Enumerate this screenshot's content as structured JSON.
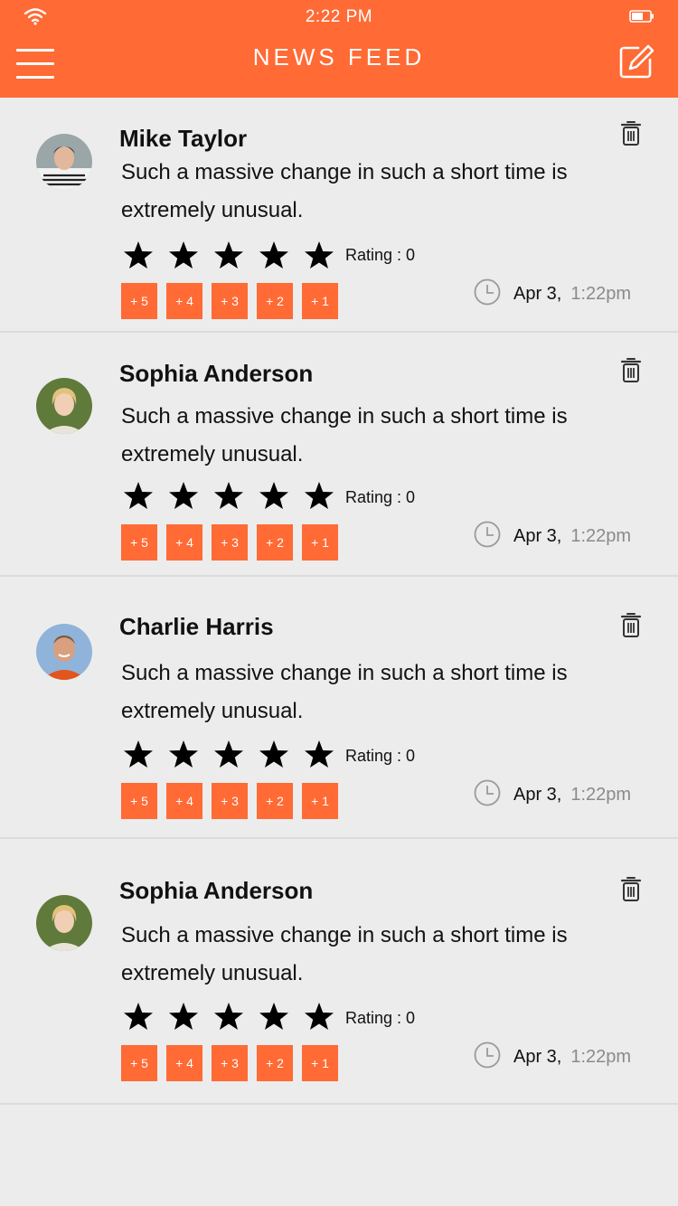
{
  "status_bar": {
    "time": "2:22 PM"
  },
  "header": {
    "title": "NEWS FEED"
  },
  "colors": {
    "accent": "#ff6a35",
    "background": "#ececec"
  },
  "posts": [
    {
      "name": "Mike Taylor",
      "message": "Such a massive change in such a short time is extremely unusual.",
      "rating_label": "Rating : 0",
      "stars": 5,
      "chips": [
        "+ 5",
        "+ 4",
        "+ 3",
        "+ 2",
        "+ 1"
      ],
      "date": "Apr 3,",
      "time": "1:22pm",
      "avatar_icon": "user-avatar-1"
    },
    {
      "name": "Sophia Anderson",
      "message": "Such a massive change in such a short time is extremely unusual.",
      "rating_label": "Rating : 0",
      "stars": 5,
      "chips": [
        "+ 5",
        "+ 4",
        "+ 3",
        "+ 2",
        "+ 1"
      ],
      "date": "Apr 3,",
      "time": "1:22pm",
      "avatar_icon": "user-avatar-2"
    },
    {
      "name": "Charlie Harris",
      "message": "Such a massive change in such a short time is extremely unusual.",
      "rating_label": "Rating : 0",
      "stars": 5,
      "chips": [
        "+ 5",
        "+ 4",
        "+ 3",
        "+ 2",
        "+ 1"
      ],
      "date": "Apr 3,",
      "time": "1:22pm",
      "avatar_icon": "user-avatar-3"
    },
    {
      "name": "Sophia Anderson",
      "message": "Such a massive change in such a short time is extremely unusual.",
      "rating_label": "Rating : 0",
      "stars": 5,
      "chips": [
        "+ 5",
        "+ 4",
        "+ 3",
        "+ 2",
        "+ 1"
      ],
      "date": "Apr 3,",
      "time": "1:22pm",
      "avatar_icon": "user-avatar-2"
    }
  ]
}
